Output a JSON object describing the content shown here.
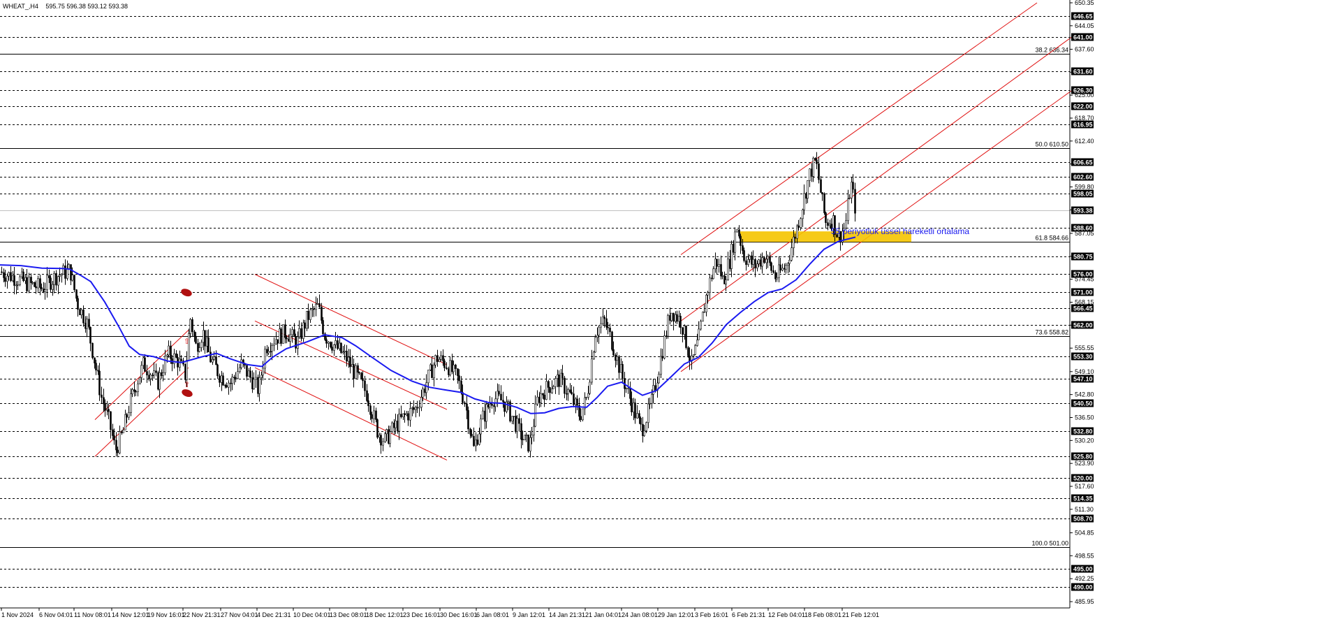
{
  "header": {
    "symbol": "WHEAT_,H4",
    "ohlc": "595.75 596.38 593.12 593.38"
  },
  "annotation": "55 periyotluk üssel hareketli ortalama",
  "colors": {
    "candle": "#000000",
    "ema": "#1a1af0",
    "channel": "#e01010",
    "zone": "#f5c400",
    "grid": "#000000",
    "current_price": "#c0c0c0",
    "marker": "#b01010"
  },
  "chart_data": {
    "type": "candlestick",
    "symbol": "WHEAT_",
    "timeframe": "H4",
    "ylim": [
      485.95,
      650.35
    ],
    "y_ticks": [
      650.35,
      644.05,
      637.6,
      631.3,
      625.0,
      618.7,
      612.4,
      606.1,
      599.8,
      593.5,
      587.05,
      580.75,
      574.45,
      568.15,
      561.85,
      555.55,
      549.1,
      542.8,
      536.5,
      530.2,
      523.9,
      517.6,
      511.3,
      504.85,
      498.55,
      492.25,
      485.95
    ],
    "x_labels": [
      "1 Nov 2024",
      "6 Nov 04:01",
      "11 Nov 08:01",
      "14 Nov 12:01",
      "19 Nov 16:01",
      "22 Nov 21:31",
      "27 Nov 04:01",
      "4 Dec 21:31",
      "10 Dec 04:01",
      "13 Dec 08:01",
      "18 Dec 12:01",
      "23 Dec 16:01",
      "30 Dec 16:01",
      "6 Jan 08:01",
      "9 Jan 12:01",
      "14 Jan 21:31",
      "21 Jan 04:01",
      "24 Jan 08:01",
      "29 Jan 12:01",
      "3 Feb 16:01",
      "6 Feb 21:31",
      "12 Feb 04:01",
      "18 Feb 08:01",
      "21 Feb 12:01"
    ],
    "current_price": 593.38,
    "horizontal_levels": [
      646.65,
      641.0,
      631.6,
      626.3,
      622.0,
      616.95,
      606.65,
      602.6,
      598.05,
      588.6,
      580.75,
      576.0,
      571.0,
      566.45,
      562.0,
      553.3,
      547.1,
      540.5,
      532.8,
      525.8,
      520.0,
      514.35,
      508.7,
      495.0,
      490.0
    ],
    "fibonacci": [
      {
        "label": "38.2 636.34",
        "value": 636.34
      },
      {
        "label": "50.0 610.50",
        "value": 610.5
      },
      {
        "label": "61.8 584.66",
        "value": 584.66
      },
      {
        "label": "73.6 558.82",
        "value": 558.82
      },
      {
        "label": "100.0 501.00",
        "value": 501.0
      }
    ],
    "ema_period": 55,
    "support_zone": [
      584.7,
      587.6
    ],
    "ema_path": [
      [
        0,
        578.4
      ],
      [
        30,
        578.2
      ],
      [
        60,
        577.5
      ],
      [
        90,
        577.4
      ],
      [
        100,
        577.2
      ],
      [
        115,
        575.6
      ],
      [
        130,
        573.8
      ],
      [
        150,
        568.2
      ],
      [
        170,
        561.5
      ],
      [
        185,
        556.1
      ],
      [
        200,
        553.8
      ],
      [
        220,
        553.2
      ],
      [
        240,
        552.0
      ],
      [
        260,
        551.6
      ],
      [
        290,
        553.2
      ],
      [
        310,
        554.1
      ],
      [
        330,
        552.6
      ],
      [
        355,
        551.0
      ],
      [
        375,
        550.5
      ],
      [
        390,
        553.0
      ],
      [
        410,
        555.4
      ],
      [
        440,
        557.3
      ],
      [
        465,
        559.2
      ],
      [
        490,
        558.4
      ],
      [
        510,
        556.1
      ],
      [
        530,
        553.4
      ],
      [
        560,
        549.4
      ],
      [
        590,
        546.5
      ],
      [
        615,
        544.8
      ],
      [
        640,
        544.0
      ],
      [
        660,
        543.4
      ],
      [
        680,
        541.6
      ],
      [
        700,
        540.6
      ],
      [
        720,
        540.4
      ],
      [
        740,
        539.3
      ],
      [
        760,
        537.6
      ],
      [
        780,
        537.8
      ],
      [
        800,
        539.0
      ],
      [
        820,
        539.5
      ],
      [
        840,
        539.3
      ],
      [
        855,
        542.0
      ],
      [
        870,
        545.1
      ],
      [
        890,
        546.2
      ],
      [
        905,
        544.3
      ],
      [
        920,
        542.6
      ],
      [
        940,
        543.9
      ],
      [
        960,
        547.5
      ],
      [
        980,
        551.2
      ],
      [
        1000,
        553.0
      ],
      [
        1020,
        557.0
      ],
      [
        1040,
        562.0
      ],
      [
        1060,
        565.3
      ],
      [
        1080,
        568.3
      ],
      [
        1100,
        570.8
      ],
      [
        1120,
        571.8
      ],
      [
        1140,
        574.3
      ],
      [
        1160,
        578.7
      ],
      [
        1180,
        582.7
      ],
      [
        1200,
        584.8
      ],
      [
        1210,
        585.3
      ],
      [
        1225,
        586.0
      ]
    ],
    "channels": [
      {
        "name": "",
        "lines": [
          [
            [
              136,
              535.9
            ],
            [
              270,
              560.5
            ]
          ],
          [
            [
              136,
              525.8
            ],
            [
              270,
              550.2
            ]
          ]
        ]
      },
      {
        "name": "",
        "lines": [
          [
            [
              365,
              575.8
            ],
            [
              640,
              551.0
            ]
          ],
          [
            [
              365,
              563.0
            ],
            [
              640,
              538.7
            ]
          ],
          [
            [
              365,
              550.2
            ],
            [
              640,
              524.8
            ]
          ]
        ]
      },
      {
        "name": "",
        "lines": [
          [
            [
              975,
              581.2
            ],
            [
              1485,
              650.35
            ]
          ],
          [
            [
              975,
              563.0
            ],
            [
              1535,
              641.0
            ]
          ],
          [
            [
              975,
              549.1
            ],
            [
              1535,
              626.3
            ]
          ]
        ]
      }
    ],
    "markers": [
      {
        "type": "up-arrow",
        "x": 267,
        "y": 557.5
      },
      {
        "type": "up-arrow",
        "x": 267,
        "y": 545.6
      }
    ],
    "candles_note": "Price rises from ~525 in Dec/Jan to a high near 608 in mid Feb, last close 593.38",
    "price_path": [
      [
        0,
        576.5
      ],
      [
        20,
        575.0
      ],
      [
        40,
        573.2
      ],
      [
        60,
        572.0
      ],
      [
        80,
        575.3
      ],
      [
        100,
        577.0
      ],
      [
        110,
        568.0
      ],
      [
        125,
        562.0
      ],
      [
        135,
        552.0
      ],
      [
        145,
        542.0
      ],
      [
        155,
        536.0
      ],
      [
        165,
        527.5
      ],
      [
        175,
        532.0
      ],
      [
        185,
        540.0
      ],
      [
        195,
        546.0
      ],
      [
        205,
        551.0
      ],
      [
        215,
        549.0
      ],
      [
        225,
        546.0
      ],
      [
        240,
        554.0
      ],
      [
        255,
        552.0
      ],
      [
        265,
        548.0
      ],
      [
        272,
        564.0
      ],
      [
        280,
        556.0
      ],
      [
        290,
        560.0
      ],
      [
        300,
        553.0
      ],
      [
        315,
        548.0
      ],
      [
        330,
        546.0
      ],
      [
        345,
        551.0
      ],
      [
        360,
        547.0
      ],
      [
        370,
        544.0
      ],
      [
        380,
        556.0
      ],
      [
        395,
        558.5
      ],
      [
        410,
        560.0
      ],
      [
        425,
        557.0
      ],
      [
        440,
        564.0
      ],
      [
        455,
        567.0
      ],
      [
        465,
        559.0
      ],
      [
        480,
        556.0
      ],
      [
        495,
        553.0
      ],
      [
        510,
        548.0
      ],
      [
        525,
        543.0
      ],
      [
        540,
        533.0
      ],
      [
        550,
        530.0
      ],
      [
        565,
        534.0
      ],
      [
        580,
        537.0
      ],
      [
        595,
        539.0
      ],
      [
        610,
        546.0
      ],
      [
        625,
        553.0
      ],
      [
        640,
        551.0
      ],
      [
        655,
        547.0
      ],
      [
        665,
        541.0
      ],
      [
        678,
        528.0
      ],
      [
        690,
        536.0
      ],
      [
        705,
        542.0
      ],
      [
        720,
        541.0
      ],
      [
        735,
        536.0
      ],
      [
        750,
        530.0
      ],
      [
        758,
        529.0
      ],
      [
        770,
        542.0
      ],
      [
        785,
        545.0
      ],
      [
        800,
        547.0
      ],
      [
        815,
        543.0
      ],
      [
        830,
        537.0
      ],
      [
        840,
        542.0
      ],
      [
        852,
        560.0
      ],
      [
        865,
        563.0
      ],
      [
        878,
        556.0
      ],
      [
        890,
        548.0
      ],
      [
        905,
        540.0
      ],
      [
        918,
        533.0
      ],
      [
        932,
        540.0
      ],
      [
        945,
        552.0
      ],
      [
        960,
        566.0
      ],
      [
        975,
        563.0
      ],
      [
        990,
        551.0
      ],
      [
        1000,
        558.0
      ],
      [
        1012,
        571.0
      ],
      [
        1025,
        580.0
      ],
      [
        1035,
        574.0
      ],
      [
        1045,
        580.0
      ],
      [
        1055,
        589.0
      ],
      [
        1065,
        581.0
      ],
      [
        1080,
        578.0
      ],
      [
        1095,
        581.0
      ],
      [
        1110,
        575.0
      ],
      [
        1125,
        578.0
      ],
      [
        1140,
        588.0
      ],
      [
        1150,
        596.0
      ],
      [
        1160,
        604.0
      ],
      [
        1168,
        607.0
      ],
      [
        1175,
        598.0
      ],
      [
        1182,
        590.0
      ],
      [
        1192,
        591.0
      ],
      [
        1200,
        586.0
      ],
      [
        1210,
        589.0
      ],
      [
        1218,
        601.0
      ],
      [
        1225,
        593.38
      ]
    ]
  }
}
